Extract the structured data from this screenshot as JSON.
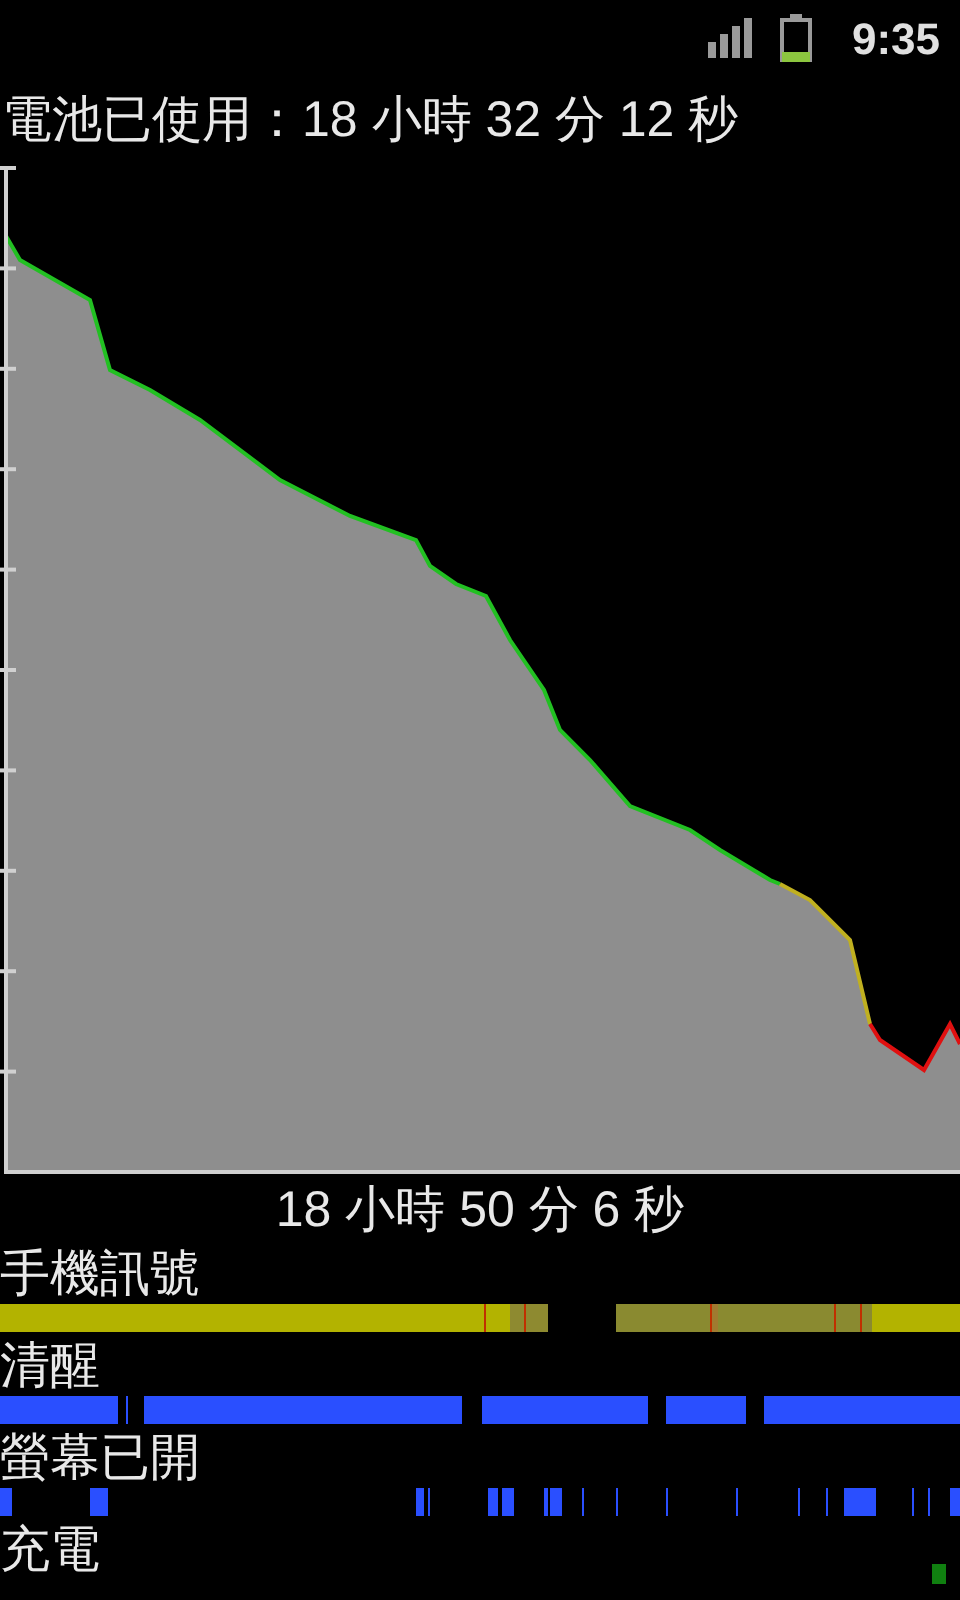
{
  "status_bar": {
    "time": "9:35"
  },
  "title": "電池已使用：18 小時 32 分 12 秒",
  "chart_duration": "18 小時 50 分 6 秒",
  "tracks": [
    {
      "label": "手機訊號"
    },
    {
      "label": "清醒"
    },
    {
      "label": "螢幕已開"
    },
    {
      "label": "充電"
    }
  ]
}
